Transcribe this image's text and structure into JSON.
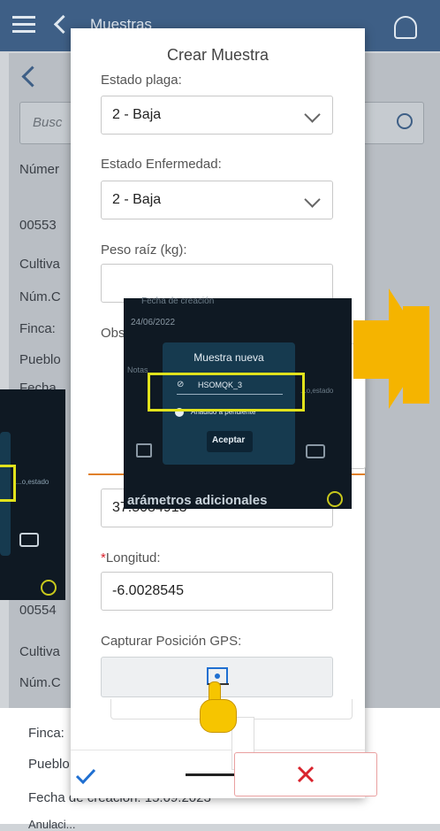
{
  "background_app": {
    "title": "Muestras",
    "search_placeholder": "Busc",
    "column_label": "Númer",
    "records": [
      {
        "id": "00553",
        "fields": [
          "Cultiva",
          "Núm.C",
          "Finca:",
          "Pueblo",
          "Fecha"
        ]
      },
      {
        "id": "00554",
        "fields": [
          "Cultiva",
          "Núm.C",
          "Finca:",
          "Pueblo",
          "Fecha de creación: 15.09.2023"
        ]
      }
    ],
    "bottom_partial_text": "Anulaci..."
  },
  "dialog": {
    "title": "Crear Muestra",
    "fields": [
      {
        "label": "Estado plaga:",
        "value": "2 - Baja",
        "type": "select"
      },
      {
        "label": "Estado Enfermedad:",
        "value": "2 - Baja",
        "type": "select"
      },
      {
        "label": "Peso raíz (kg):",
        "value": "",
        "type": "text"
      },
      {
        "label": "Obs",
        "value": "",
        "type": "textarea"
      }
    ],
    "latitude_value": "37.5084913",
    "longitude_label": "Longitud:",
    "longitude_required_mark": "*",
    "longitude_value": "-6.0028545",
    "gps_label": "Capturar Posición GPS:",
    "confirm_icon": "check-icon",
    "cancel_icon": "close-icon"
  },
  "overlay_popup": {
    "header_text": "Fecha de creación",
    "date_text": "24/06/2022",
    "left_text": "Notas",
    "right_text": "...o,estado",
    "card_title": "Muestra nueva",
    "code": "HSOMQK_3",
    "info_text": "Añadido a pendiente",
    "accept_label": "Aceptar",
    "footer_text": "arámetros adicionales"
  },
  "overlay_left": {
    "text": "...o,estado"
  },
  "colors": {
    "appbar": "#3e5f86",
    "accent_red": "#d9232d",
    "check_blue": "#1f6fd1",
    "highlight_yellow": "#e1e21c",
    "arrow_orange": "#f5b400",
    "dark_bg": "#0f1923"
  }
}
